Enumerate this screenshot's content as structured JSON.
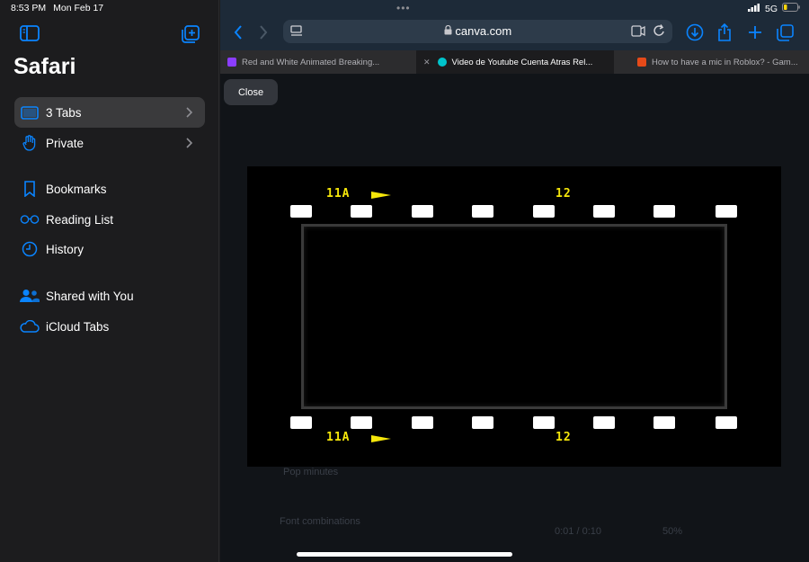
{
  "status": {
    "time": "8:53 PM",
    "date": "Mon Feb 17",
    "network": "5G"
  },
  "sidebar": {
    "title": "Safari",
    "items": [
      {
        "label": "3 Tabs",
        "icon": "tabs-icon",
        "selected": true,
        "chevron": true
      },
      {
        "label": "Private",
        "icon": "hand-icon",
        "selected": false,
        "chevron": true
      },
      {
        "label": "Bookmarks",
        "icon": "bookmark-icon"
      },
      {
        "label": "Reading List",
        "icon": "glasses-icon"
      },
      {
        "label": "History",
        "icon": "clock-icon"
      },
      {
        "label": "Shared with You",
        "icon": "people-icon"
      },
      {
        "label": "iCloud Tabs",
        "icon": "cloud-icon"
      }
    ]
  },
  "browser": {
    "url": "canva.com",
    "tabs": [
      {
        "title": "Red and White Animated Breaking...",
        "favicon_color": "#8b3dff",
        "active": false
      },
      {
        "title": "Video de Youtube Cuenta Atras Rel...",
        "favicon_color": "#00c4cc",
        "active": true
      },
      {
        "title": "How to have a mic in Roblox? - Gam...",
        "favicon_color": "#e64a19",
        "active": false
      }
    ],
    "close_label": "Close"
  },
  "video": {
    "top_left_label": "11A",
    "top_right_label": "12",
    "bottom_left_label": "11A",
    "bottom_right_label": "12"
  },
  "background_page": {
    "item1": "Pop minutes",
    "item2": "Font combinations",
    "time": "0:01 / 0:10",
    "zoom": "50%"
  },
  "colors": {
    "accent": "#0a84ff",
    "film_label": "#f5e60a"
  }
}
